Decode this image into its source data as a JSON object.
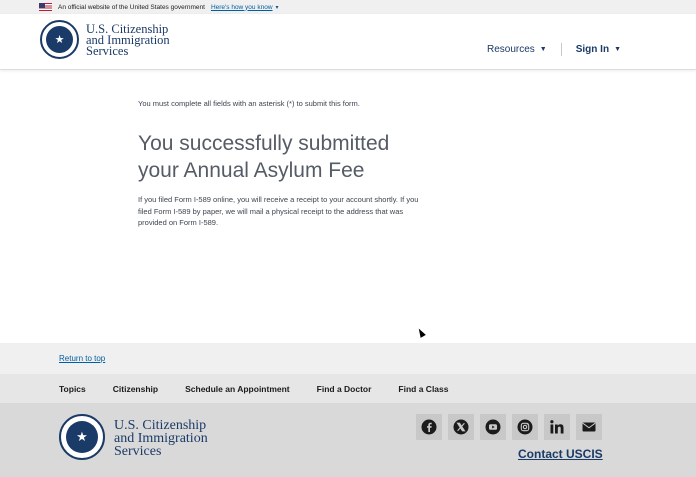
{
  "gov_banner": {
    "text": "An official website of the United States government",
    "link_label": "Here's how you know"
  },
  "header": {
    "logo_line1": "U.S. Citizenship",
    "logo_line2": "and Immigration",
    "logo_line3": "Services",
    "nav": {
      "resources": "Resources",
      "sign_in": "Sign In"
    }
  },
  "main": {
    "required_note": "You must complete all fields with an asterisk (*) to submit this form.",
    "title_line1": "You successfully submitted",
    "title_line2": "your Annual Asylum Fee",
    "body": "If you filed Form I-589 online, you will receive a receipt to your account shortly. If you filed Form I-589 by paper, we will mail a physical receipt to the address that was provided on Form I-589."
  },
  "footer": {
    "return_to_top": "Return to top",
    "nav_links": [
      "Topics",
      "Citizenship",
      "Schedule an Appointment",
      "Find a Doctor",
      "Find a Class"
    ],
    "logo_line1": "U.S. Citizenship",
    "logo_line2": "and Immigration",
    "logo_line3": "Services",
    "socials": [
      "facebook-icon",
      "x-icon",
      "youtube-icon",
      "instagram-icon",
      "linkedin-icon",
      "email-icon"
    ],
    "contact": "Contact USCIS"
  },
  "colors": {
    "brand_navy": "#1a3a67",
    "link_blue": "#005ea2"
  }
}
